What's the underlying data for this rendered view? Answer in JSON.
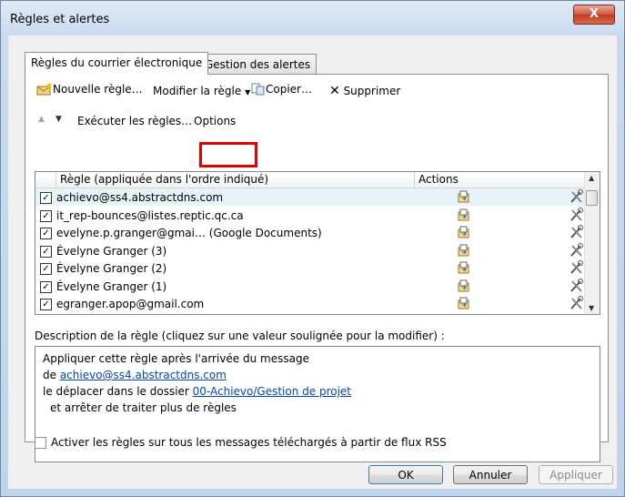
{
  "window": {
    "title": "Règles et alertes",
    "close_label": "X"
  },
  "tabs": [
    {
      "label": "Règles du courrier électronique"
    },
    {
      "label": "Gestion des alertes"
    }
  ],
  "toolbar": {
    "new_rule": "Nouvelle règle…",
    "modify_rule": "Modifier la règle",
    "copy": "Copier…",
    "delete": "Supprimer",
    "run_rules": "Exécuter les règles…",
    "options": "Options"
  },
  "list": {
    "col_rule": "Règle (appliquée dans l'ordre indiqué)",
    "col_actions": "Actions",
    "rows": [
      {
        "name": "achievo@ss4.abstractdns.com",
        "checked": true
      },
      {
        "name": "it_rep-bounces@listes.reptic.qc.ca",
        "checked": true
      },
      {
        "name": "evelyne.p.granger@gmai… (Google Documents)",
        "checked": true
      },
      {
        "name": "Évelyne Granger (3)",
        "checked": true
      },
      {
        "name": "Évelyne Granger (2)",
        "checked": true
      },
      {
        "name": "Évelyne Granger (1)",
        "checked": true
      },
      {
        "name": "egranger.apop@gmail.com",
        "checked": true
      }
    ],
    "icons": [
      "move-to-folder-icon",
      "rule-settings-icon"
    ]
  },
  "description": {
    "label": "Description de la règle (cliquez sur une valeur soulignée pour la modifier) :",
    "line1": "Appliquer cette règle après l'arrivée du message",
    "line2_prefix": "de ",
    "line2_link": "achievo@ss4.abstractdns.com",
    "line3_prefix": "le déplacer dans le dossier ",
    "line3_link": "00-Achievo/Gestion de projet",
    "line4": "et arrêter de traiter plus de règles"
  },
  "rss": {
    "label": "Activer les règles sur tous les messages téléchargés à partir de flux RSS",
    "checked": false
  },
  "buttons": {
    "ok": "OK",
    "cancel": "Annuler",
    "apply": "Appliquer"
  },
  "colors": {
    "highlight": "#e00000",
    "link": "#0645ad"
  }
}
